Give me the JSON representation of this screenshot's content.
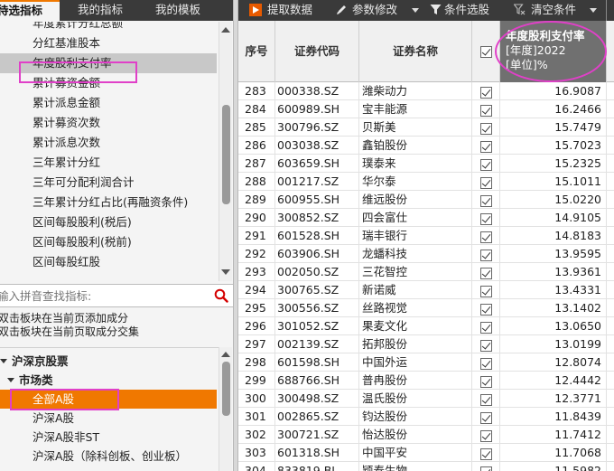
{
  "left": {
    "tabs": [
      "待选指标",
      "我的指标",
      "我的模板"
    ],
    "indicators": [
      {
        "label": "年度累计分红总额",
        "selected": false
      },
      {
        "label": "分红基准股本",
        "selected": false
      },
      {
        "label": "年度股利支付率",
        "selected": true
      },
      {
        "label": "累计募资金额",
        "selected": false
      },
      {
        "label": "累计派息金额",
        "selected": false
      },
      {
        "label": "累计募资次数",
        "selected": false
      },
      {
        "label": "累计派息次数",
        "selected": false
      },
      {
        "label": "三年累计分红",
        "selected": false
      },
      {
        "label": "三年可分配利润合计",
        "selected": false
      },
      {
        "label": "三年累计分红占比(再融资条件)",
        "selected": false
      },
      {
        "label": "区间每股股利(税后)",
        "selected": false
      },
      {
        "label": "区间每股股利(税前)",
        "selected": false
      },
      {
        "label": "区间每股红股",
        "selected": false
      }
    ],
    "search_placeholder": "输入拼音查找指标:",
    "hints": [
      "双击板块在当前页添加成分",
      "双击板块在当前页取成分交集"
    ],
    "tree": [
      {
        "label": "沪深京股票",
        "level": 0,
        "bold": true,
        "expanded": true,
        "selected": false
      },
      {
        "label": "市场类",
        "level": 1,
        "bold": true,
        "expanded": true,
        "selected": false
      },
      {
        "label": "全部A股",
        "level": 2,
        "bold": false,
        "selected": true
      },
      {
        "label": "沪深A股",
        "level": 2,
        "bold": false,
        "selected": false
      },
      {
        "label": "沪深A股非ST",
        "level": 2,
        "bold": false,
        "selected": false
      },
      {
        "label": "沪深A股（除科创板、创业板）",
        "level": 2,
        "bold": false,
        "selected": false
      }
    ]
  },
  "toolbar": {
    "fetch": "提取数据",
    "modify": "参数修改",
    "filter": "条件选股",
    "clear": "清空条件"
  },
  "grid": {
    "headers": {
      "index": "序号",
      "code": "证券代码",
      "name": "证券名称",
      "indicator_title": "年度股利支付率",
      "indicator_year": "[年度]2022",
      "indicator_unit": "[单位]%"
    },
    "rows": [
      {
        "index": "283",
        "code": "000338.SZ",
        "name": "潍柴动力",
        "value": "16.9087"
      },
      {
        "index": "284",
        "code": "600989.SH",
        "name": "宝丰能源",
        "value": "16.2466"
      },
      {
        "index": "285",
        "code": "300796.SZ",
        "name": "贝斯美",
        "value": "15.7479"
      },
      {
        "index": "286",
        "code": "003038.SZ",
        "name": "鑫铂股份",
        "value": "15.7023"
      },
      {
        "index": "287",
        "code": "603659.SH",
        "name": "璞泰来",
        "value": "15.2325"
      },
      {
        "index": "288",
        "code": "001217.SZ",
        "name": "华尔泰",
        "value": "15.1011"
      },
      {
        "index": "289",
        "code": "600955.SH",
        "name": "维远股份",
        "value": "15.0220"
      },
      {
        "index": "290",
        "code": "300852.SZ",
        "name": "四会富仕",
        "value": "14.9105"
      },
      {
        "index": "291",
        "code": "601528.SH",
        "name": "瑞丰银行",
        "value": "14.8183"
      },
      {
        "index": "292",
        "code": "603906.SH",
        "name": "龙蟠科技",
        "value": "13.9595"
      },
      {
        "index": "293",
        "code": "002050.SZ",
        "name": "三花智控",
        "value": "13.9361"
      },
      {
        "index": "294",
        "code": "300765.SZ",
        "name": "新诺威",
        "value": "13.4331"
      },
      {
        "index": "295",
        "code": "300556.SZ",
        "name": "丝路视觉",
        "value": "13.1402"
      },
      {
        "index": "296",
        "code": "301052.SZ",
        "name": "果麦文化",
        "value": "13.0650"
      },
      {
        "index": "297",
        "code": "002139.SZ",
        "name": "拓邦股份",
        "value": "13.0199"
      },
      {
        "index": "298",
        "code": "601598.SH",
        "name": "中国外运",
        "value": "12.8074"
      },
      {
        "index": "299",
        "code": "688766.SH",
        "name": "普冉股份",
        "value": "12.4442"
      },
      {
        "index": "300",
        "code": "300498.SZ",
        "name": "温氏股份",
        "value": "12.3771"
      },
      {
        "index": "301",
        "code": "002865.SZ",
        "name": "钧达股份",
        "value": "11.8439"
      },
      {
        "index": "302",
        "code": "300721.SZ",
        "name": "怡达股份",
        "value": "11.7412"
      },
      {
        "index": "303",
        "code": "601318.SH",
        "name": "中国平安",
        "value": "11.7068"
      },
      {
        "index": "304",
        "code": "833819.BJ",
        "name": "颖泰生物",
        "value": "11.5982"
      }
    ]
  },
  "colors": {
    "toolbar_bg": "#3a3a3a",
    "accent": "#f07800",
    "highlight": "#e040c8",
    "header_special_bg": "#707070"
  }
}
